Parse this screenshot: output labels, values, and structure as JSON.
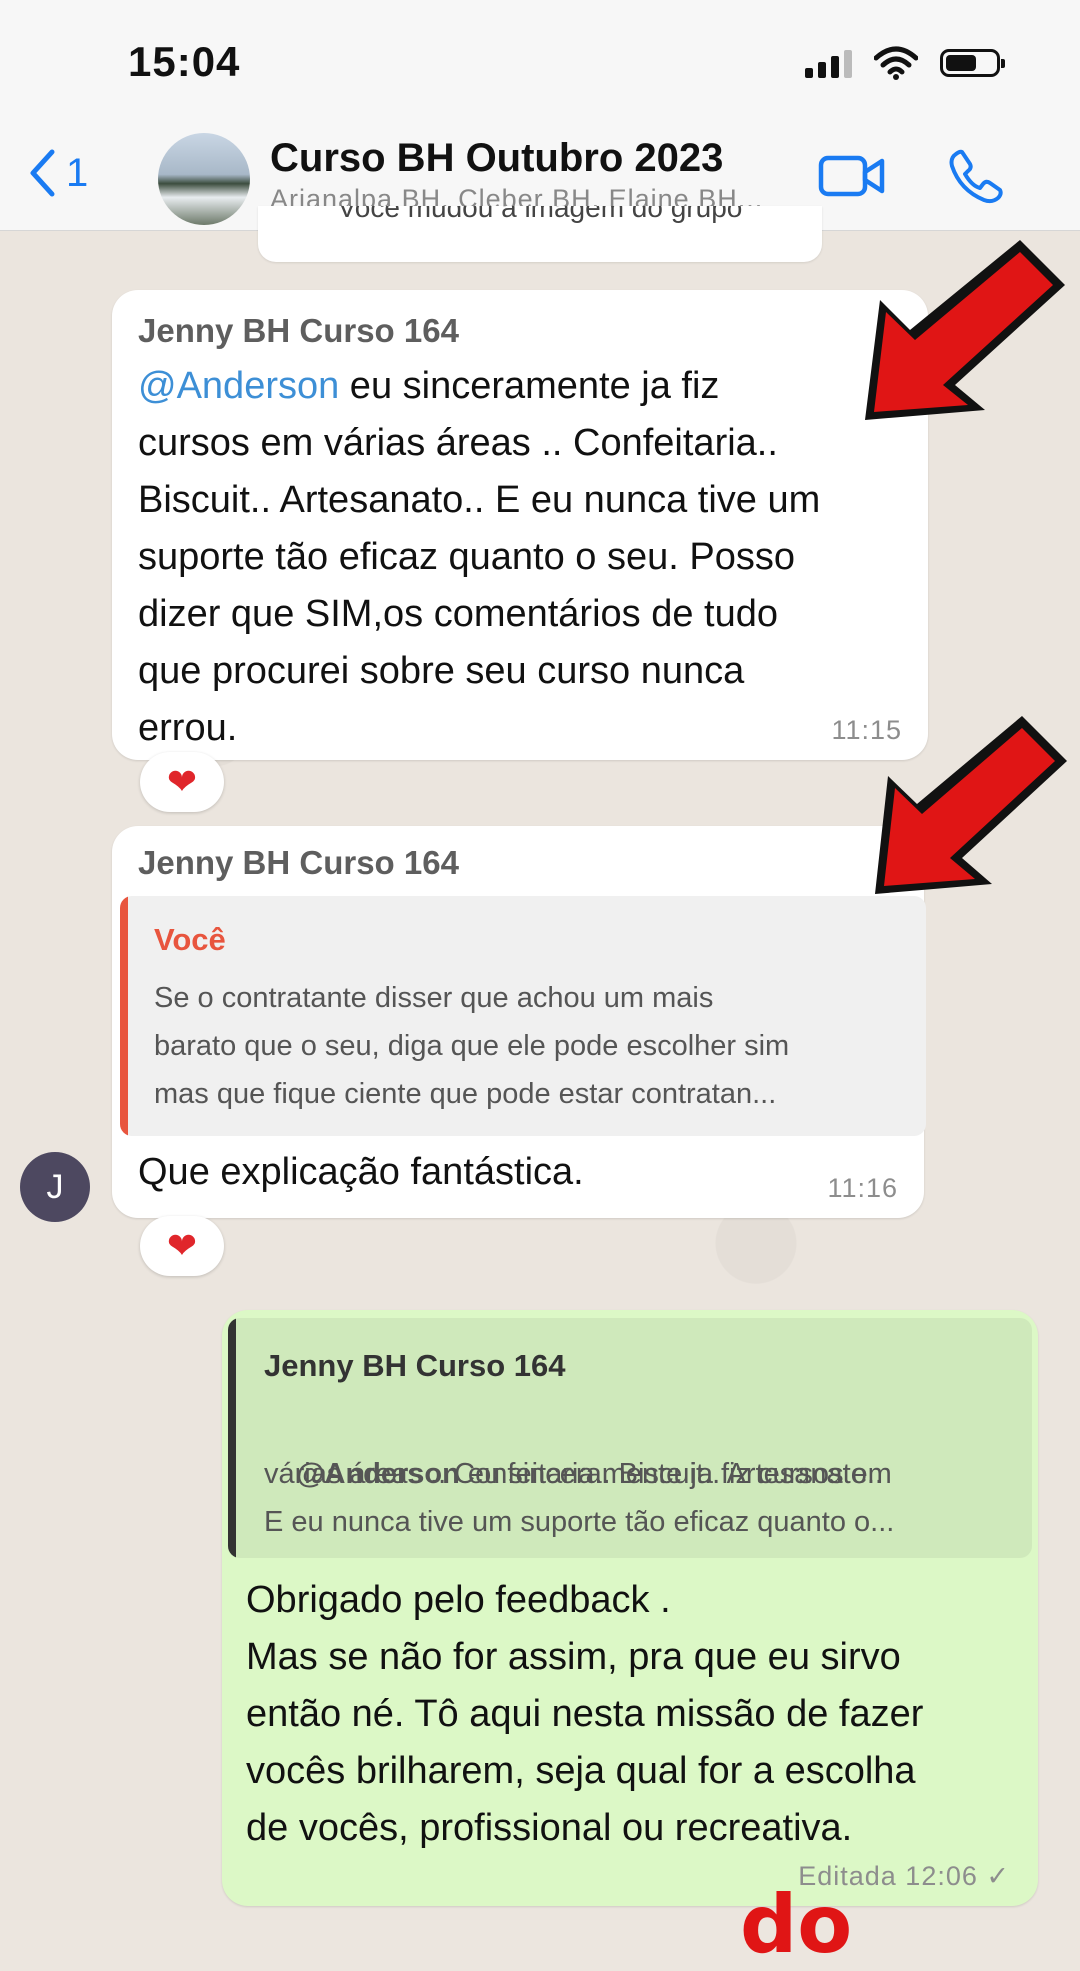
{
  "status_bar": {
    "time": "15:04"
  },
  "header": {
    "back_count": "1",
    "title": "Curso BH Outubro 2023",
    "subtitle": "Arianalpa BH, Cleber BH, Elaine BH..."
  },
  "system_message": "Você mudou a imagem do grupo",
  "messages": [
    {
      "sender": "Jenny BH Curso 164",
      "mention": "@Anderson",
      "line1_rest": " eu sinceramente ja fiz",
      "body": "cursos em várias áreas .. Confeitaria..\nBiscuit.. Artesanato.. E eu nunca tive um\nsuporte tão eficaz quanto o seu. Posso\ndizer que SIM,os comentários de tudo\nque procurei sobre seu curso nunca\nerrou.",
      "time": "11:15",
      "reaction": "❤"
    },
    {
      "sender": "Jenny BH Curso 164",
      "quote_author": "Você",
      "quote_text": "Se o contratante disser que achou um mais\nbarato que o seu, diga que ele pode escolher sim\nmas que fique ciente que pode estar contratan...",
      "body": "Que explicação fantástica.",
      "time": "11:16",
      "reaction": "❤",
      "avatar_initial": "J"
    },
    {
      "quote_author": "Jenny BH Curso 164",
      "quote_mention": "@Anderson",
      "quote_line1_rest": " eu sinceramente ja fiz cursos em",
      "quote_rest": "várias áreas .. Confeitaria.. Biscuit.. Artesanato..\nE eu nunca tive um suporte tão eficaz quanto o...",
      "body": "Obrigado pelo feedback .\nMas se não for assim, pra que eu sirvo\nentão né. Tô aqui nesta missão de fazer\nvocês brilharem, seja qual for a escolha\nde vocês, profissional ou recreativa.",
      "time": "Editada 12:06 ✓"
    }
  ],
  "colors": {
    "accent": "#1a7bf2",
    "outgoing_bubble": "#dcf8c6",
    "reply_bar_incoming": "#e8553e",
    "annotation_red": "#e01515"
  },
  "overlay_text": "do"
}
